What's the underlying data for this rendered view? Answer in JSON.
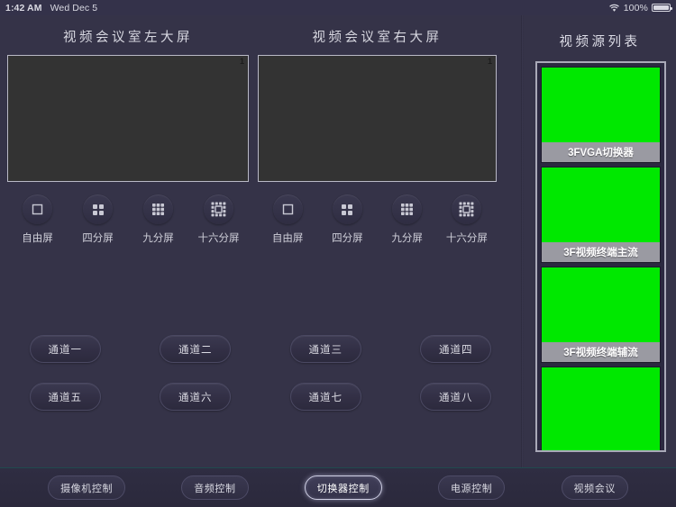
{
  "statusbar": {
    "time": "1:42 AM",
    "date": "Wed Dec 5",
    "battery_pct": "100%",
    "wifi_icon": "wifi-icon",
    "battery_icon": "battery-full-icon"
  },
  "screens": [
    {
      "title": "视频会议室左大屏",
      "number": "1",
      "modes": [
        {
          "label": "自由屏",
          "icon": "single-screen-icon"
        },
        {
          "label": "四分屏",
          "icon": "quad-split-icon"
        },
        {
          "label": "九分屏",
          "icon": "nine-split-icon"
        },
        {
          "label": "十六分屏",
          "icon": "sixteen-split-icon"
        }
      ]
    },
    {
      "title": "视频会议室右大屏",
      "number": "1",
      "modes": [
        {
          "label": "自由屏",
          "icon": "single-screen-icon"
        },
        {
          "label": "四分屏",
          "icon": "quad-split-icon"
        },
        {
          "label": "九分屏",
          "icon": "nine-split-icon"
        },
        {
          "label": "十六分屏",
          "icon": "sixteen-split-icon"
        }
      ]
    }
  ],
  "channels": {
    "row1": [
      "通道一",
      "通道二",
      "通道三",
      "通道四"
    ],
    "row2": [
      "通道五",
      "通道六",
      "通道七",
      "通道八"
    ]
  },
  "sidebar": {
    "title": "视频源列表",
    "sources": [
      {
        "caption": "3FVGA切换器",
        "color": "#00e800"
      },
      {
        "caption": "3F视频终端主流",
        "color": "#00e800"
      },
      {
        "caption": "3F视频终端辅流",
        "color": "#00e800"
      },
      {
        "caption": "",
        "color": "#00e800"
      }
    ]
  },
  "tabbar": {
    "tabs": [
      {
        "label": "摄像机控制",
        "active": false
      },
      {
        "label": "音频控制",
        "active": false
      },
      {
        "label": "切换器控制",
        "active": true
      },
      {
        "label": "电源控制",
        "active": false
      },
      {
        "label": "视频会议",
        "active": false
      }
    ]
  },
  "colors": {
    "background": "#353348",
    "panel": "#2b2940",
    "preview": "#333333",
    "source_green": "#00e800",
    "caption_bar": "#9a9aa2",
    "accent_glow": "#cfcfe4"
  }
}
